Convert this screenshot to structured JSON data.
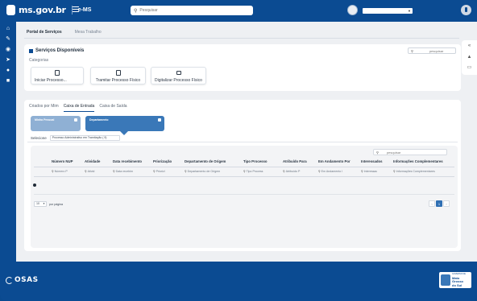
{
  "header": {
    "brand": "ms.gov.br",
    "app": "e-MS",
    "search_placeholder": "Pesquisar"
  },
  "tabs": [
    {
      "label": "Portal de Serviços",
      "active": true
    },
    {
      "label": "Mesa Trabalho",
      "active": false
    }
  ],
  "services": {
    "title": "Serviços Disponíveis",
    "subtitle": "Categorias",
    "search_placeholder": "pesquisar",
    "buttons": [
      {
        "label": "Iniciar Processo..."
      },
      {
        "label": "Tramitar Processo Físico"
      },
      {
        "label": "Digitalizar Processo Físico"
      }
    ]
  },
  "boxes": {
    "tabs": [
      {
        "label": "Criados por Mim",
        "active": false
      },
      {
        "label": "Caixa de Entrada",
        "active": true
      },
      {
        "label": "Caixa de Saída",
        "active": false
      }
    ],
    "tiles": [
      {
        "label": "Minha Pessoal"
      },
      {
        "label": "Departamento"
      }
    ],
    "select_label": "Selecione",
    "select_value": "Processo Administrativo em Tramitação ( 9)"
  },
  "table": {
    "search_placeholder": "pesquisar",
    "columns": [
      "Número NUP",
      "Atividade",
      "Data recebimento",
      "Priorização",
      "Departamento de Origem",
      "Tipo Processo",
      "Atribuído Para",
      "Em Andamento Por",
      "Interessados",
      "Informações Complementares"
    ],
    "filters": [
      "Número P",
      "Ativid",
      "Data recebim",
      "Priorizi",
      "Departamento de Origem",
      "Tipo Process",
      "Atribuído P",
      "Em Andamento l",
      "Interessac",
      "Informações Complementares"
    ],
    "per_page": "10",
    "per_page_label": "por página",
    "pages": [
      "‹",
      "1",
      "›"
    ],
    "current_page": "1"
  },
  "footer": {
    "brand": "OSAS",
    "gov_lines": [
      "GOVERNO DE",
      "Mato",
      "Grosso",
      "do Sul"
    ]
  },
  "colors": {
    "primary": "#0b4b92",
    "accent": "#3a78b8",
    "tile_light": "#8fb0d4"
  }
}
